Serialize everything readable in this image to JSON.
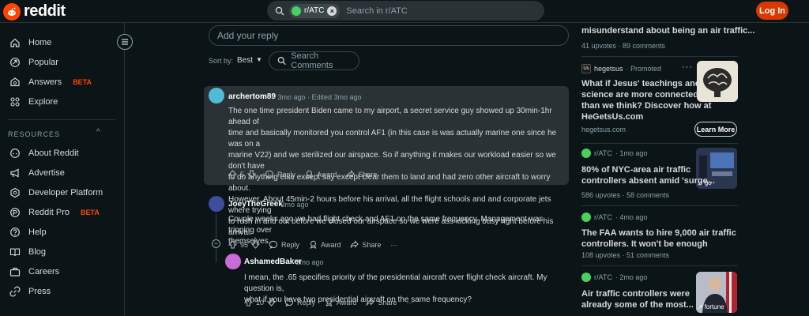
{
  "header": {
    "logo_text": "reddit",
    "search_chip": "r/ATC",
    "search_placeholder": "Search in r/ATC",
    "login_label": "Log In"
  },
  "sidebar": {
    "items": [
      {
        "label": "Home",
        "icon": "home-icon"
      },
      {
        "label": "Popular",
        "icon": "popular-icon"
      },
      {
        "label": "Answers",
        "icon": "answers-icon",
        "badge": "BETA"
      },
      {
        "label": "Explore",
        "icon": "explore-icon"
      }
    ],
    "resources_title": "RESOURCES",
    "resources": [
      {
        "label": "About Reddit",
        "icon": "reddit-icon"
      },
      {
        "label": "Advertise",
        "icon": "megaphone-icon"
      },
      {
        "label": "Developer Platform",
        "icon": "developer-icon"
      },
      {
        "label": "Reddit Pro",
        "icon": "reddit-pro-icon",
        "badge": "BETA"
      },
      {
        "label": "Help",
        "icon": "help-icon"
      },
      {
        "label": "Blog",
        "icon": "blog-icon"
      },
      {
        "label": "Careers",
        "icon": "careers-icon"
      },
      {
        "label": "Press",
        "icon": "press-icon"
      }
    ]
  },
  "comments_area": {
    "reply_placeholder": "Add your reply",
    "sort_label": "Sort by:",
    "sort_value": "Best",
    "search_comments": "Search Comments"
  },
  "comments": [
    {
      "author": "archertom89",
      "meta": "· 3mo ago · Edited 3mo ago",
      "lines": [
        "The one time president Biden came to my airport, a secret service guy showed up 30min-1hr ahead of",
        "time and basically monitored you control AF1 (in this case is was actually marine one since he was on a",
        "marine V22) and we sterilized our airspace. So if anything it makes our workload easier so we don't have",
        "to do anything else except say except clear them to land and had zero other aircraft to worry about.",
        "However, About 45min-2 hours before his arrival, all the flight schools and and corporate jets where trying",
        "to rush in and out before we closed our airspace so we were ass kicking busy right before his arrival."
      ],
      "votes": "5",
      "reply": "Reply",
      "award": "Award",
      "share": "Share"
    },
    {
      "author": "JoeyTheGreek",
      "meta": "· 3mo ago",
      "lines": [
        "Couple weeks ago we had flight check and AF1 on the same frequency. Management was tripping over",
        "themselves."
      ],
      "votes": "95",
      "reply": "Reply",
      "award": "Award",
      "share": "Share",
      "more": "···"
    },
    {
      "author": "AshamedBaker",
      "meta": "· 3mo ago",
      "lines": [
        "I mean, the .65 specifies priority of the presidential aircraft over flight check aircraft. My question is,",
        "what if you have two presidential aircraft on the same frequency?"
      ],
      "votes": "10",
      "reply": "Reply",
      "award": "Award",
      "share": "Share",
      "more": "···"
    }
  ],
  "related": {
    "top_title": "misunderstand about being an air traffic...",
    "top_meta": "41 upvotes · 89 comments",
    "promo": {
      "user": "hegetsus",
      "tag": "· Promoted",
      "title_lines": [
        "What if Jesus' teachings and",
        "science are more connected",
        "than we think? Discover how at",
        "HeGetsUs.com"
      ],
      "domain": "hegetsus.com",
      "cta": "Learn More",
      "avatar_text": "Us"
    },
    "posts": [
      {
        "sub": "r/ATC",
        "age": "· 1mo ago",
        "title_lines": [
          "80% of NYC-area air traffic",
          "controllers absent amid 'surge..."
        ],
        "meta": "586 upvotes · 58 comments",
        "thumb_badge": "go"
      },
      {
        "sub": "r/ATC",
        "age": "· 4mo ago",
        "title_lines": [
          "The FAA wants to hire 9,000 air traffic",
          "controllers. It won't be enough"
        ],
        "meta": "108 upvotes · 51 comments"
      },
      {
        "sub": "r/ATC",
        "age": "· 2mo ago",
        "title_lines": [
          "Air traffic controllers were",
          "already some of the most..."
        ],
        "thumb_badge": "fortune"
      }
    ],
    "more": "···"
  }
}
